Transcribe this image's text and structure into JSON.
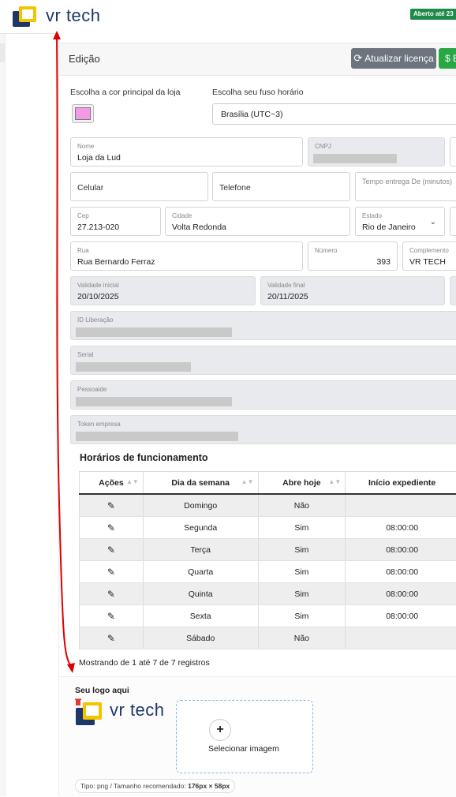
{
  "header": {
    "logo_text": "vr tech",
    "open_badge": "Aberto até 23"
  },
  "card": {
    "title": "Edição",
    "refresh_label": "Atualizar licença",
    "green_label": "$ E"
  },
  "settings": {
    "color_label": "Escolha a cor principal da loja",
    "color_value": "#f29ae6",
    "timezone_label": "Escolha seu fuso horário",
    "timezone_value": "Brasília (UTC−3)"
  },
  "form": {
    "nome": {
      "label": "Nome",
      "value": "Loja da Lud"
    },
    "cnpj": {
      "label": "CNPJ"
    },
    "celular": {
      "placeholder": "Celular"
    },
    "telefone": {
      "placeholder": "Telefone"
    },
    "tempo_entrega": {
      "label": "Tempo entrega De (minutos)"
    },
    "cep": {
      "label": "Cep",
      "value": "27.213-020"
    },
    "cidade": {
      "label": "Cidade",
      "value": "Volta Redonda"
    },
    "estado": {
      "label": "Estado",
      "value": "Rio de Janeiro"
    },
    "rua": {
      "label": "Rua",
      "value": "Rua Bernardo Ferraz"
    },
    "numero": {
      "label": "Número",
      "value": "393"
    },
    "complemento": {
      "label": "Complemento",
      "value": "VR TECH"
    },
    "validade_inicial": {
      "label": "Validade inicial",
      "value": "20/10/2025"
    },
    "validade_final": {
      "label": "Validade final",
      "value": "20/11/2025"
    },
    "id_liberacao": {
      "label": "ID Liberação"
    },
    "serial": {
      "label": "Serial"
    },
    "pessoaide": {
      "label": "Pessoaide"
    },
    "token_empresa": {
      "label": "Token empresa"
    }
  },
  "hours": {
    "title": "Horários de funcionamento",
    "columns": [
      "Ações",
      "Dia da semana",
      "Abre hoje",
      "Início expediente"
    ],
    "rows": [
      {
        "day": "Domingo",
        "open": "Não",
        "start": ""
      },
      {
        "day": "Segunda",
        "open": "Sim",
        "start": "08:00:00"
      },
      {
        "day": "Terça",
        "open": "Sim",
        "start": "08:00:00"
      },
      {
        "day": "Quarta",
        "open": "Sim",
        "start": "08:00:00"
      },
      {
        "day": "Quinta",
        "open": "Sim",
        "start": "08:00:00"
      },
      {
        "day": "Sexta",
        "open": "Sim",
        "start": "08:00:00"
      },
      {
        "day": "Sábado",
        "open": "Não",
        "start": ""
      }
    ],
    "showing": "Mostrando de 1 até 7 de 7 registros"
  },
  "logo_upload": {
    "label": "Seu logo aqui",
    "logo_text": "vr tech",
    "select_label": "Selecionar imagem",
    "hint_prefix": "Tipo: png / Tamanho recomendado: ",
    "hint_size": "176px × 58px"
  }
}
